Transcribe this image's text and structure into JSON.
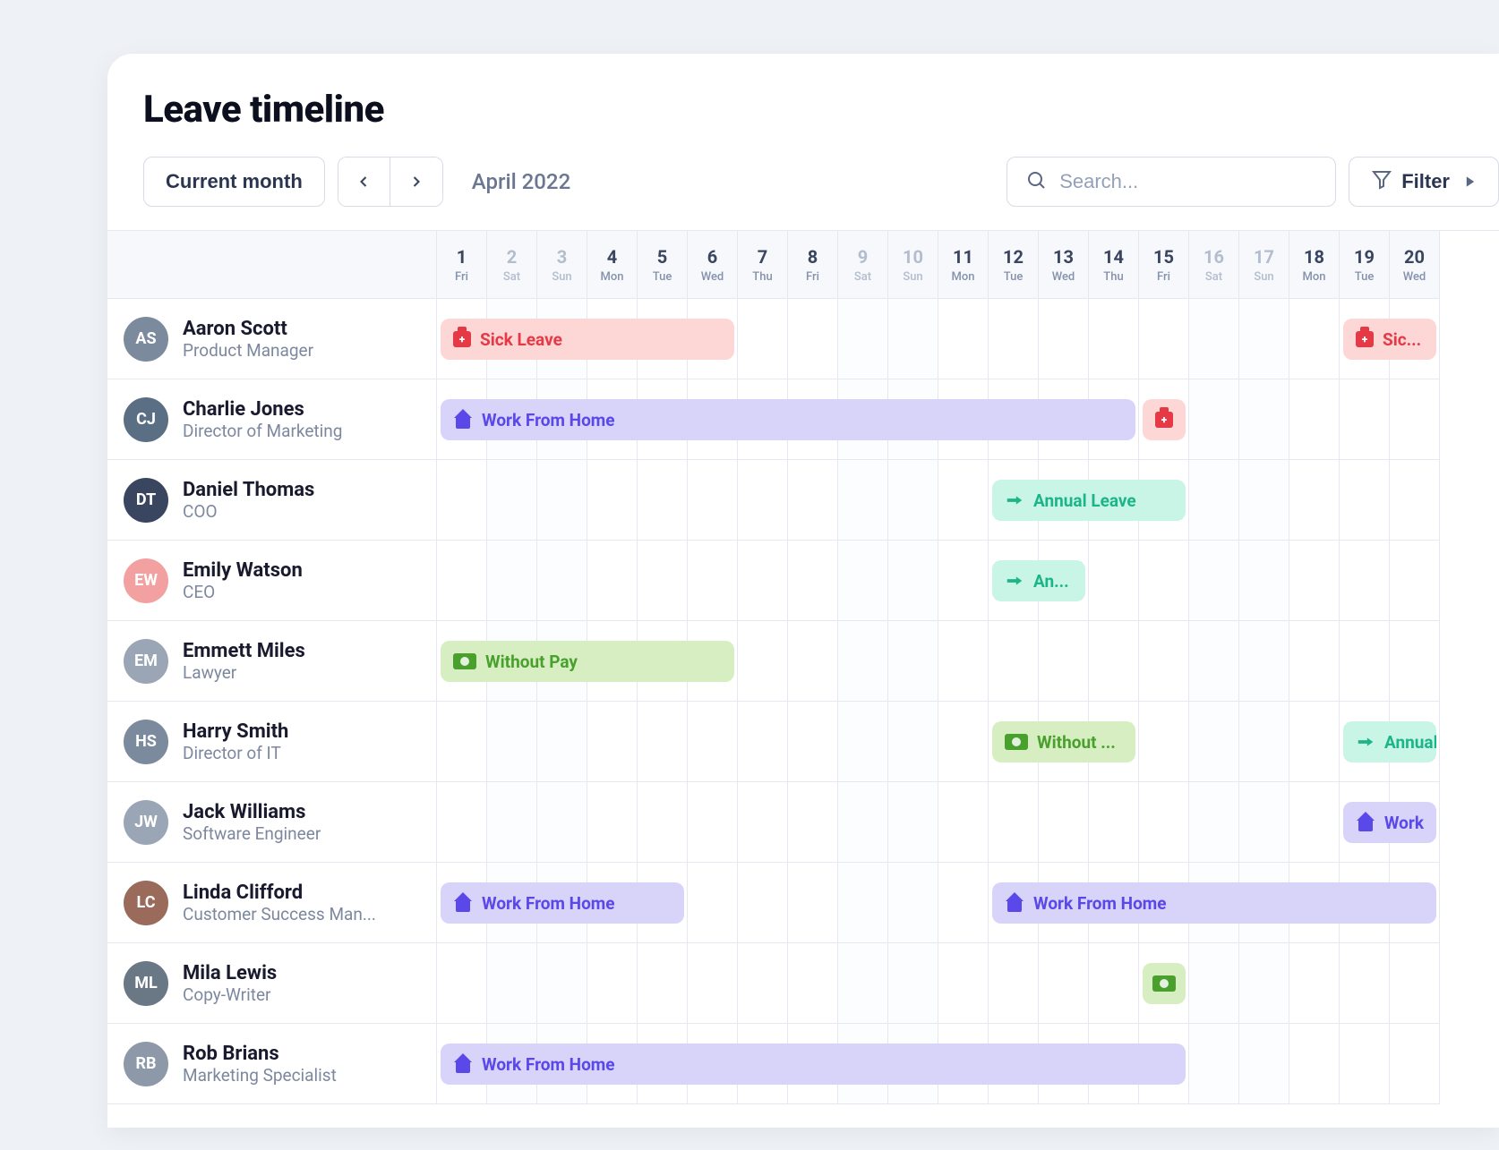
{
  "title": "Leave timeline",
  "toolbar": {
    "current_month_label": "Current month",
    "month_label": "April 2022",
    "search_placeholder": "Search...",
    "filter_label": "Filter"
  },
  "date_headers": [
    {
      "num": "1",
      "dow": "Fri",
      "weekend": false
    },
    {
      "num": "2",
      "dow": "Sat",
      "weekend": true
    },
    {
      "num": "3",
      "dow": "Sun",
      "weekend": true
    },
    {
      "num": "4",
      "dow": "Mon",
      "weekend": false
    },
    {
      "num": "5",
      "dow": "Tue",
      "weekend": false
    },
    {
      "num": "6",
      "dow": "Wed",
      "weekend": false
    },
    {
      "num": "7",
      "dow": "Thu",
      "weekend": false
    },
    {
      "num": "8",
      "dow": "Fri",
      "weekend": false
    },
    {
      "num": "9",
      "dow": "Sat",
      "weekend": true
    },
    {
      "num": "10",
      "dow": "Sun",
      "weekend": true
    },
    {
      "num": "11",
      "dow": "Mon",
      "weekend": false
    },
    {
      "num": "12",
      "dow": "Tue",
      "weekend": false
    },
    {
      "num": "13",
      "dow": "Wed",
      "weekend": false
    },
    {
      "num": "14",
      "dow": "Thu",
      "weekend": false
    },
    {
      "num": "15",
      "dow": "Fri",
      "weekend": false
    },
    {
      "num": "16",
      "dow": "Sat",
      "weekend": true
    },
    {
      "num": "17",
      "dow": "Sun",
      "weekend": true
    },
    {
      "num": "18",
      "dow": "Mon",
      "weekend": false
    },
    {
      "num": "19",
      "dow": "Tue",
      "weekend": false
    },
    {
      "num": "20",
      "dow": "Wed",
      "weekend": false
    }
  ],
  "people": [
    {
      "name": "Aaron Scott",
      "role": "Product Manager",
      "avatar": "#7c8a9e"
    },
    {
      "name": "Charlie Jones",
      "role": "Director of Marketing",
      "avatar": "#5b6f84"
    },
    {
      "name": "Daniel Thomas",
      "role": "COO",
      "avatar": "#3a4660"
    },
    {
      "name": "Emily Watson",
      "role": "CEO",
      "avatar": "#f2a0a0"
    },
    {
      "name": "Emmett Miles",
      "role": "Lawyer",
      "avatar": "#9aa6b5"
    },
    {
      "name": "Harry Smith",
      "role": "Director of IT",
      "avatar": "#7c8a9e"
    },
    {
      "name": "Jack Williams",
      "role": "Software Engineer",
      "avatar": "#9aa6b5"
    },
    {
      "name": "Linda Clifford",
      "role": "Customer Success Man...",
      "avatar": "#9a6b5a"
    },
    {
      "name": "Mila Lewis",
      "role": "Copy-Writer",
      "avatar": "#6a7785"
    },
    {
      "name": "Rob Brians",
      "role": "Marketing Specialist",
      "avatar": "#8d99a8"
    }
  ],
  "events": [
    {
      "row": 0,
      "start": 1,
      "end": 6,
      "type": "sick",
      "label": "Sick Leave"
    },
    {
      "row": 0,
      "start": 19,
      "end": 20,
      "type": "sick",
      "label": "Sic..."
    },
    {
      "row": 1,
      "start": 1,
      "end": 14,
      "type": "wfh",
      "label": "Work From Home"
    },
    {
      "row": 1,
      "start": 15,
      "end": 15,
      "type": "sick",
      "label": "",
      "icon_only": true
    },
    {
      "row": 2,
      "start": 12,
      "end": 15,
      "type": "annual",
      "label": "Annual Leave"
    },
    {
      "row": 3,
      "start": 12,
      "end": 13,
      "type": "annual",
      "label": "An..."
    },
    {
      "row": 4,
      "start": 1,
      "end": 6,
      "type": "nopay",
      "label": "Without Pay"
    },
    {
      "row": 5,
      "start": 12,
      "end": 14,
      "type": "nopay",
      "label": "Without ..."
    },
    {
      "row": 5,
      "start": 19,
      "end": 20,
      "type": "annual",
      "label": "Annual"
    },
    {
      "row": 6,
      "start": 19,
      "end": 20,
      "type": "wfh",
      "label": "Work"
    },
    {
      "row": 7,
      "start": 1,
      "end": 5,
      "type": "wfh",
      "label": "Work From Home"
    },
    {
      "row": 7,
      "start": 12,
      "end": 20,
      "type": "wfh",
      "label": "Work From Home"
    },
    {
      "row": 8,
      "start": 15,
      "end": 15,
      "type": "nopay",
      "label": "",
      "icon_only": true
    },
    {
      "row": 9,
      "start": 1,
      "end": 15,
      "type": "wfh",
      "label": "Work From Home"
    }
  ],
  "leave_types": {
    "sick": {
      "label": "Sick Leave",
      "bg": "#fdd6d6",
      "fg": "#e63946",
      "icon": "briefcase"
    },
    "wfh": {
      "label": "Work From Home",
      "bg": "#d8d4f9",
      "fg": "#5a48e8",
      "icon": "home"
    },
    "annual": {
      "label": "Annual Leave",
      "bg": "#c9f5e6",
      "fg": "#1cb587",
      "icon": "plane"
    },
    "nopay": {
      "label": "Without Pay",
      "bg": "#d7eec3",
      "fg": "#4aa02c",
      "icon": "cash"
    }
  }
}
